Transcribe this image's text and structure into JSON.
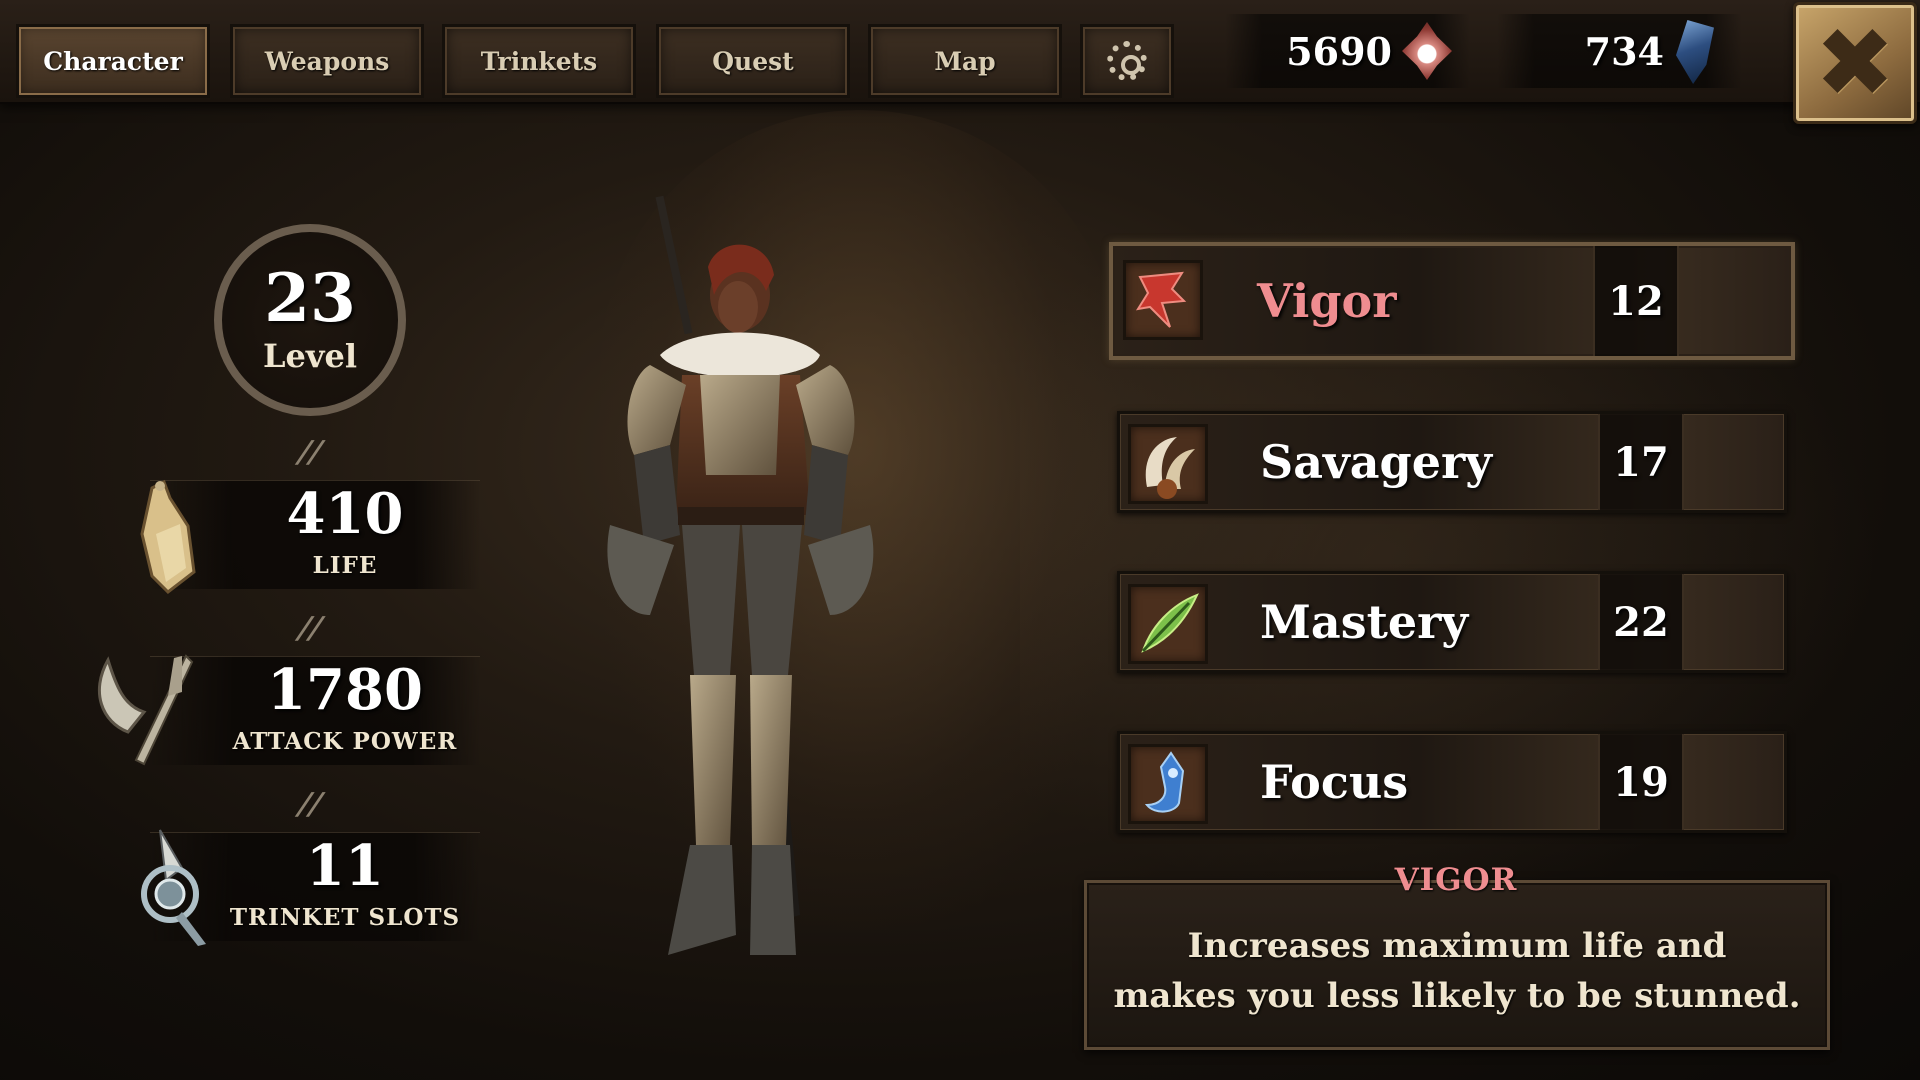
{
  "tabs": [
    {
      "label": "Character",
      "active": true
    },
    {
      "label": "Weapons",
      "active": false
    },
    {
      "label": "Trinkets",
      "active": false
    },
    {
      "label": "Quest",
      "active": false
    },
    {
      "label": "Map",
      "active": false
    }
  ],
  "settings": {
    "icon": "gear-icon"
  },
  "currencies": [
    {
      "value": "5690",
      "icon": "blood-orb-icon",
      "color": "#b4473e"
    },
    {
      "value": "734",
      "icon": "blue-shard-icon",
      "color": "#3b6aa8"
    }
  ],
  "close": {
    "icon": "close-icon"
  },
  "level": {
    "value": "23",
    "label": "Level"
  },
  "stats": [
    {
      "value": "410",
      "label": "LIFE",
      "icon": "flask-icon"
    },
    {
      "value": "1780",
      "label": "ATTACK POWER",
      "icon": "axe-icon"
    },
    {
      "value": "11",
      "label": "TRINKET SLOTS",
      "icon": "trinket-icon"
    }
  ],
  "attributes": [
    {
      "name": "Vigor",
      "value": "12",
      "icon": "vigor-icon",
      "selected": true
    },
    {
      "name": "Savagery",
      "value": "17",
      "icon": "claw-icon",
      "selected": false
    },
    {
      "name": "Mastery",
      "value": "22",
      "icon": "feather-icon",
      "selected": false
    },
    {
      "name": "Focus",
      "value": "19",
      "icon": "focus-icon",
      "selected": false
    }
  ],
  "description": {
    "title": "VIGOR",
    "line1": "Increases maximum life and",
    "line2": "makes you less likely to be stunned."
  },
  "colors": {
    "accent": "#ef8d90",
    "gold": "#c9a66b"
  }
}
